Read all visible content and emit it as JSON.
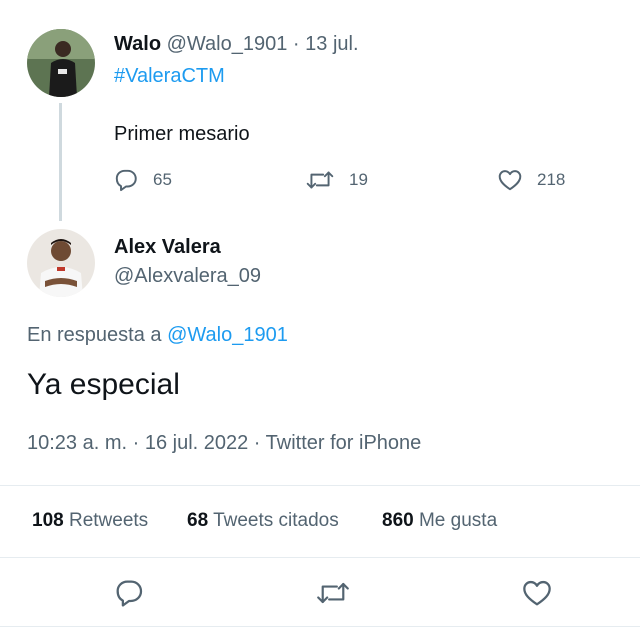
{
  "parent_tweet": {
    "author_name": "Walo",
    "handle": "@Walo_1901",
    "separator": "·",
    "date": "13 jul.",
    "hashtag": "#ValeraCTM",
    "text": "Primer mesario",
    "replies": "65",
    "retweets": "19",
    "likes": "218"
  },
  "main_tweet": {
    "author_name": "Alex Valera",
    "handle": "@Alexvalera_09",
    "reply_prefix": "En respuesta a",
    "reply_to": "@Walo_1901",
    "text": "Ya especial",
    "meta": "10:23 a. m. · 16 jul. 2022 · Twitter for iPhone"
  },
  "stats": {
    "retweets_count": "108",
    "retweets_label": "Retweets",
    "quotes_count": "68",
    "quotes_label": "Tweets citados",
    "likes_count": "860",
    "likes_label": "Me gusta"
  },
  "icons": {
    "reply": "reply-icon",
    "retweet": "retweet-icon",
    "like": "heart-icon"
  },
  "colors": {
    "link": "#1d9bf0",
    "muted": "#536471",
    "text": "#0f1419"
  }
}
